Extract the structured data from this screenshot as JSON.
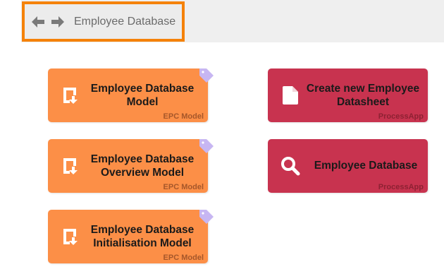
{
  "header": {
    "back_icon": "arrow-left-icon",
    "forward_icon": "arrow-right-icon",
    "title": "Employee Database",
    "highlight_color": "#f5820a"
  },
  "tiles": [
    {
      "title": "Employee Database\nModel",
      "type": "EPC Model",
      "icon": "model-download-icon",
      "color": "#fc8f47",
      "tag_icon": "tag-icon"
    },
    {
      "title": "Employee Database\nOverview Model",
      "type": "EPC Model",
      "icon": "model-download-icon",
      "color": "#fc8f47",
      "tag_icon": "tag-icon"
    },
    {
      "title": "Employee Database\nInitialisation Model",
      "type": "EPC Model",
      "icon": "model-download-icon",
      "color": "#fc8f47",
      "tag_icon": "tag-icon"
    },
    {
      "title": "Create new Employee\nDatasheet",
      "type": "ProcessApp",
      "icon": "document-icon",
      "color": "#c8334f"
    },
    {
      "title": "Employee Database",
      "type": "ProcessApp",
      "icon": "search-icon",
      "color": "#c8334f"
    }
  ]
}
